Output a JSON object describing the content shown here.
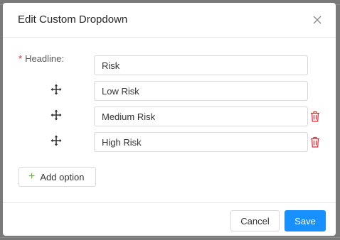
{
  "dialog": {
    "title": "Edit Custom Dropdown",
    "close_icon": "close-icon"
  },
  "form": {
    "headline_label": "Headline:",
    "required_mark": "*",
    "headline_value": "Risk",
    "options": [
      {
        "value": "Low Risk",
        "deletable": false
      },
      {
        "value": "Medium Risk",
        "deletable": true
      },
      {
        "value": "High Risk",
        "deletable": true
      }
    ],
    "add_option_label": "Add option",
    "add_icon": "+"
  },
  "footer": {
    "cancel_label": "Cancel",
    "save_label": "Save"
  },
  "colors": {
    "primary": "#1890ff",
    "danger": "#f5222d",
    "add_icon": "#52c41a"
  }
}
